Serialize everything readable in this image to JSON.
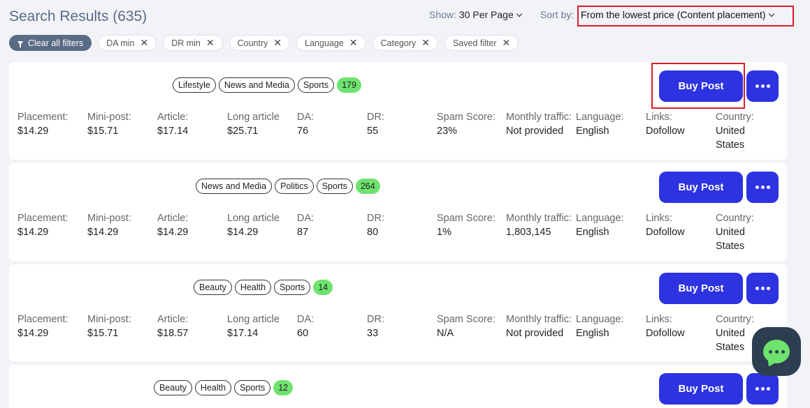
{
  "header": {
    "title": "Search Results (635)",
    "show_label": "Show:",
    "show_value": "30 Per Page",
    "sort_label": "Sort by:",
    "sort_value": "From the lowest price (Content placement)"
  },
  "filters": {
    "clear_all": "Clear all filters",
    "chips": [
      "DA min",
      "DR min",
      "Country",
      "Language",
      "Category",
      "Saved filter"
    ]
  },
  "labels": {
    "placement": "Placement:",
    "mini_post": "Mini-post:",
    "article": "Article:",
    "long_article": "Long article",
    "da": "DA:",
    "dr": "DR:",
    "spam": "Spam Score:",
    "traffic": "Monthly traffic:",
    "language": "Language:",
    "links": "Links:",
    "country": "Country:"
  },
  "buy_label": "Buy Post",
  "cards": [
    {
      "tags": [
        "Lifestyle",
        "News and Media",
        "Sports"
      ],
      "count": "179",
      "placement": "$14.29",
      "mini_post": "$15.71",
      "article": "$17.14",
      "long_article": "$25.71",
      "da": "76",
      "dr": "55",
      "spam": "23%",
      "traffic": "Not provided",
      "language": "English",
      "links": "Dofollow",
      "country": "United States"
    },
    {
      "tags": [
        "News and Media",
        "Politics",
        "Sports"
      ],
      "count": "264",
      "placement": "$14.29",
      "mini_post": "$14.29",
      "article": "$14.29",
      "long_article": "$14.29",
      "da": "87",
      "dr": "80",
      "spam": "1%",
      "traffic": "1,803,145",
      "language": "English",
      "links": "Dofollow",
      "country": "United States"
    },
    {
      "tags": [
        "Beauty",
        "Health",
        "Sports"
      ],
      "count": "14",
      "placement": "$14.29",
      "mini_post": "$15.71",
      "article": "$18.57",
      "long_article": "$17.14",
      "da": "60",
      "dr": "33",
      "spam": "N/A",
      "traffic": "Not provided",
      "language": "English",
      "links": "Dofollow",
      "country": "United States"
    },
    {
      "tags": [
        "Beauty",
        "Health",
        "Sports"
      ],
      "count": "12"
    }
  ]
}
